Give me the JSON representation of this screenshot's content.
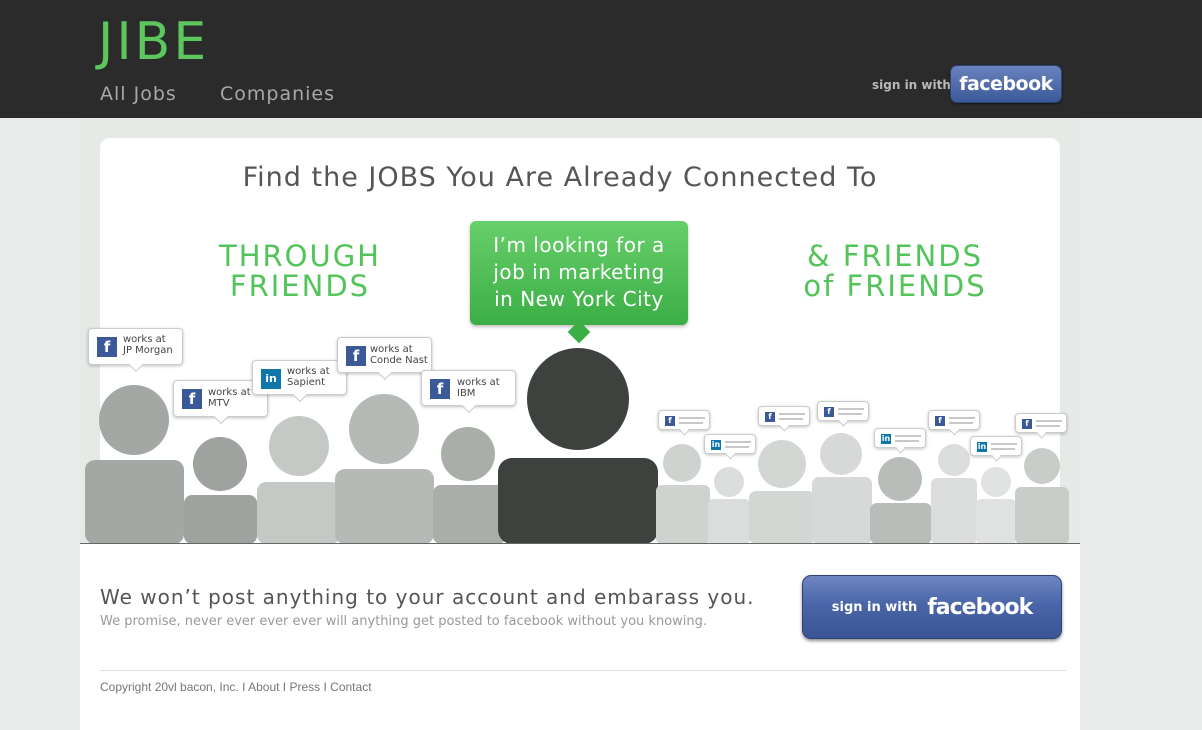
{
  "header": {
    "logo": "JIBE",
    "nav": [
      {
        "label": "All Jobs"
      },
      {
        "label": "Companies"
      }
    ],
    "signin_prefix": "sign in with",
    "facebook_label": "facebook"
  },
  "hero": {
    "title": "Find the JOBS You Are Already Connected To",
    "left_heading_1": "THROUGH",
    "left_heading_2": "FRIENDS",
    "right_heading_1": "& FRIENDS",
    "right_heading_2": "of FRIENDS",
    "speech": [
      "I’m looking for a",
      "job in marketing",
      "in New York City"
    ],
    "cards": [
      {
        "network": "facebook",
        "line1": "works at",
        "line2": "JP Morgan"
      },
      {
        "network": "facebook",
        "line1": "works at",
        "line2": "MTV"
      },
      {
        "network": "linkedin",
        "line1": "works at",
        "line2": "Sapient"
      },
      {
        "network": "facebook",
        "line1": "works at",
        "line2": "Conde Nast"
      },
      {
        "network": "facebook",
        "line1": "works at",
        "line2": "IBM"
      }
    ],
    "mini_cards": [
      "facebook",
      "linkedin",
      "facebook",
      "facebook",
      "linkedin",
      "facebook",
      "linkedin",
      "facebook"
    ]
  },
  "promise": {
    "tagline": "We won’t post anything to your account and embarass you.",
    "subline": "We promise, never ever ever ever will anything get posted to facebook without you knowing.",
    "button_prefix": "sign in with",
    "button_brand": "facebook"
  },
  "footer": {
    "copyright": "Copyright 20vl bacon, Inc.",
    "sep": " I ",
    "links": [
      "About",
      "Press",
      "Contact"
    ]
  },
  "colors": {
    "brand_green": "#52c45a",
    "facebook_blue": "#3b5998",
    "linkedin_blue": "#0e76a8",
    "topbar": "#2b2b2b"
  }
}
